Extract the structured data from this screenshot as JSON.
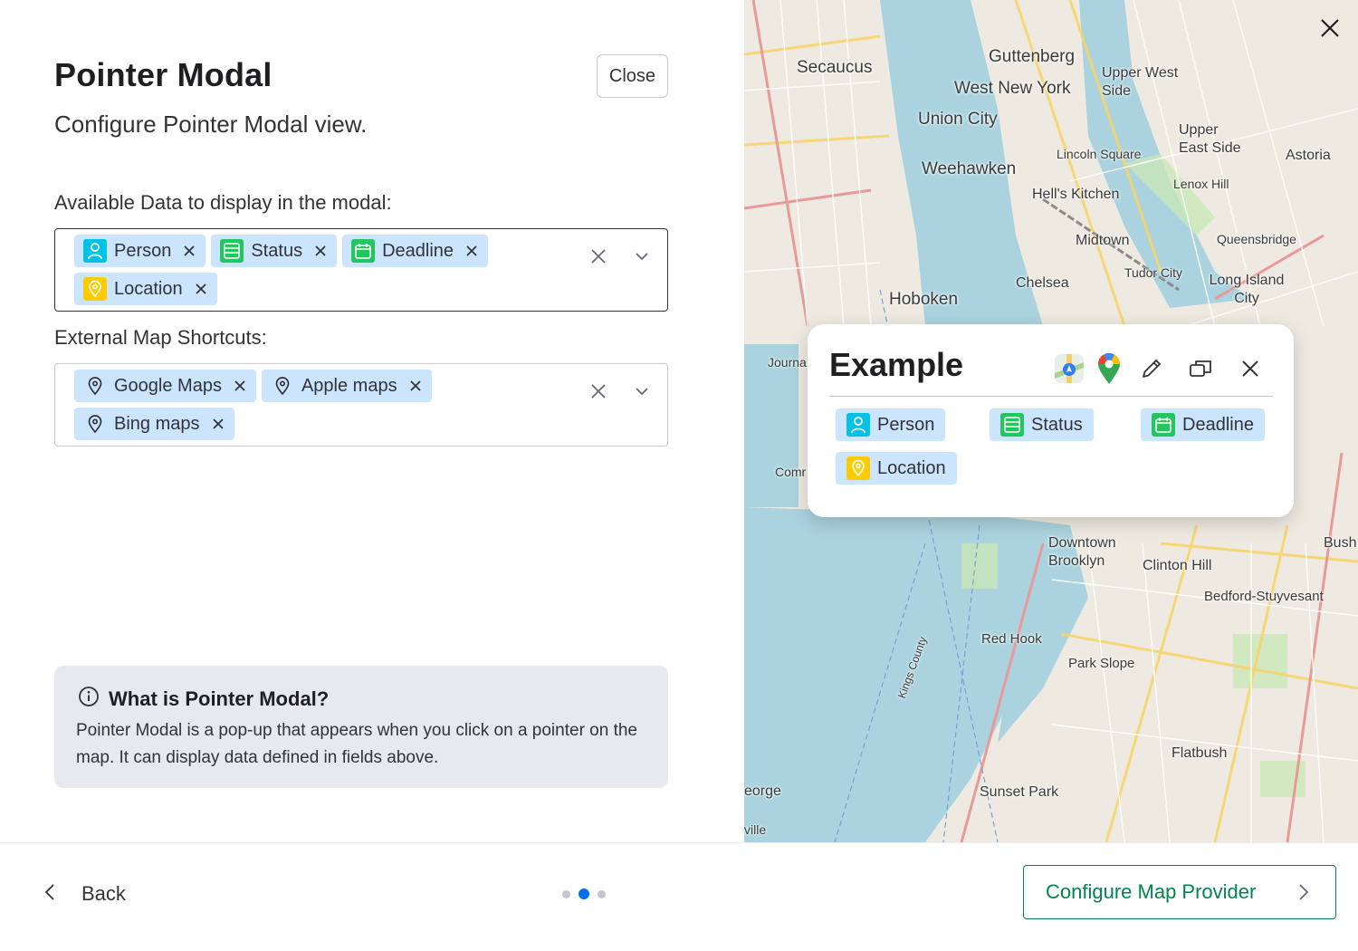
{
  "modal": {
    "title": "Pointer Modal",
    "subtitle": "Configure Pointer Modal view.",
    "close_label": "Close"
  },
  "available_data": {
    "label": "Available Data to display in the modal:",
    "chips": [
      {
        "label": "Person",
        "icon": "person-icon",
        "color": "#00c2e6"
      },
      {
        "label": "Status",
        "icon": "status-icon",
        "color": "#22c55e"
      },
      {
        "label": "Deadline",
        "icon": "calendar-icon",
        "color": "#22c55e"
      },
      {
        "label": "Location",
        "icon": "location-pin-icon",
        "color": "#ffcb00"
      }
    ]
  },
  "map_shortcuts": {
    "label": "External Map Shortcuts:",
    "chips": [
      {
        "label": "Google Maps",
        "icon": "map-pin-icon"
      },
      {
        "label": "Apple maps",
        "icon": "map-pin-icon"
      },
      {
        "label": "Bing maps",
        "icon": "map-pin-icon"
      }
    ]
  },
  "info": {
    "title": "What is Pointer Modal?",
    "body": "Pointer Modal is a pop-up that appears when you click on a pointer on the map. It can display data defined in fields above."
  },
  "preview": {
    "popup_title": "Example",
    "chips": [
      "Person",
      "Status",
      "Deadline",
      "Location"
    ],
    "map_labels": [
      "Secaucus",
      "Guttenberg",
      "West New York",
      "Union City",
      "Weehawken",
      "Upper West Side",
      "Upper East Side",
      "Astoria",
      "Lincoln Square",
      "Lenox Hill",
      "Hell's Kitchen",
      "Midtown",
      "Queensbridge",
      "Chelsea",
      "Tudor City",
      "Long Island City",
      "Hoboken",
      "Downtown Brooklyn",
      "Clinton Hill",
      "Bedford-Stuyvesant",
      "Red Hook",
      "Park Slope",
      "Flatbush",
      "Sunset Park",
      "Bush",
      "Journa",
      "Comr",
      "eorge",
      "ville",
      "Kings County"
    ]
  },
  "footer": {
    "back_label": "Back",
    "next_label": "Configure Map Provider",
    "steps_total": 3,
    "current_step": 2
  },
  "colors": {
    "chip_bg": "#cce5ff",
    "primary": "#0073ea",
    "success": "#00854d",
    "info_bg": "#e7e9ef"
  }
}
